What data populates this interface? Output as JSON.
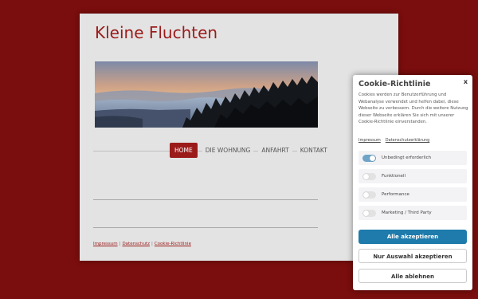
{
  "site": {
    "title": "Kleine Fluchten",
    "nav": [
      {
        "label": "HOME",
        "active": true
      },
      {
        "label": "DIE WOHNUNG",
        "active": false
      },
      {
        "label": "ANFAHRT",
        "active": false
      },
      {
        "label": "KONTAKT",
        "active": false
      }
    ],
    "footer_links": [
      "Impressum",
      "Datenschutz",
      "Cookie-Richtlinie"
    ],
    "footer_separator": "|"
  },
  "cookie": {
    "title": "Cookie-Richtlinie",
    "close_label": "x",
    "text": "Cookies werden zur Benutzerführung und Webanalyse verwendet und helfen dabei, diese Webseite zu verbessern. Durch die weitere Nutzung dieser Webseite erklären Sie sich mit unserer Cookie-Richtlinie einverstanden.",
    "links": [
      "Impressum",
      "Datenschutzerklärung"
    ],
    "options": [
      {
        "label": "Unbedingt erforderlich",
        "enabled": true
      },
      {
        "label": "Funktionell",
        "enabled": false
      },
      {
        "label": "Performance",
        "enabled": false
      },
      {
        "label": "Marketing / Third Party",
        "enabled": false
      }
    ],
    "buttons": {
      "accept_all": "Alle akzeptieren",
      "accept_selection": "Nur Auswahl akzeptieren",
      "reject_all": "Alle ablehnen"
    }
  },
  "colors": {
    "background": "#7a0d0d",
    "brand": "#9b1b1b",
    "primary_button": "#1e7bab",
    "toggle_on": "#6fa3c7"
  }
}
